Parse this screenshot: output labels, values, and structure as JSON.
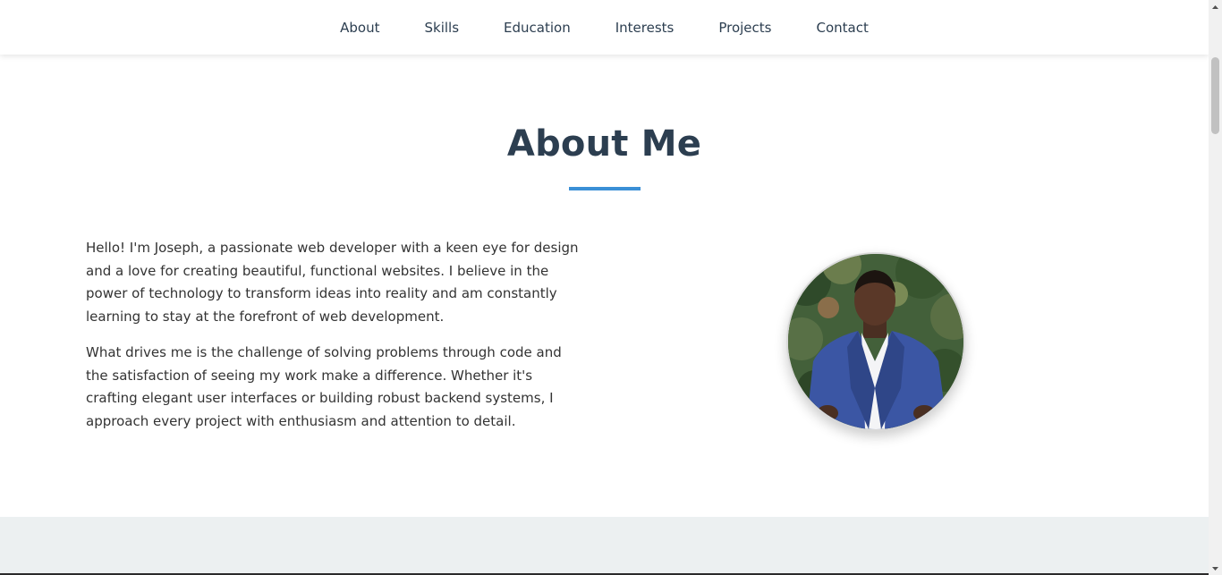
{
  "nav": {
    "items": [
      {
        "label": "About"
      },
      {
        "label": "Skills"
      },
      {
        "label": "Education"
      },
      {
        "label": "Interests"
      },
      {
        "label": "Projects"
      },
      {
        "label": "Contact"
      }
    ]
  },
  "about": {
    "title": "About Me",
    "paragraphs": [
      "Hello! I'm Joseph, a passionate web developer with a keen eye for design and a love for creating beautiful, functional websites. I believe in the power of technology to transform ideas into reality and am constantly learning to stay at the forefront of web development.",
      "What drives me is the challenge of solving problems through code and the satisfaction of seeing my work make a difference. Whether it's crafting elegant user interfaces or building robust backend systems, I approach every project with enthusiasm and attention to detail."
    ]
  },
  "colors": {
    "heading": "#2c3e50",
    "accent": "#3a8fd6",
    "body_text": "#333333",
    "section_alt_bg": "#ecf0f1"
  },
  "icons": {
    "scroll_up": "scroll-up-arrow-icon",
    "scroll_down": "scroll-down-arrow-icon"
  }
}
